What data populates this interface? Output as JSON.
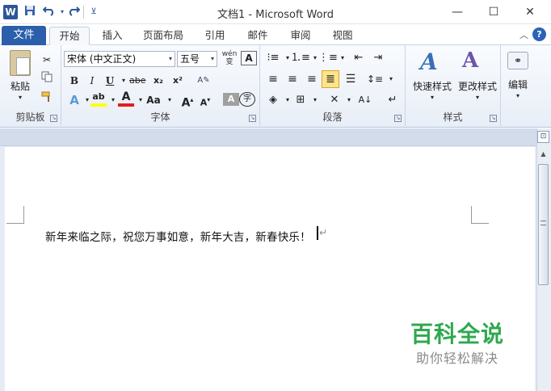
{
  "window": {
    "title": "文档1 - Microsoft Word",
    "app_icon_letter": "W",
    "controls": {
      "minimize": "—",
      "maximize": "☐",
      "close": "✕"
    }
  },
  "quick_access": {
    "save_icon": "save-icon",
    "undo_icon": "undo-icon",
    "redo_icon": "redo-icon",
    "customize_icon": "customize-qat-icon"
  },
  "tabs": {
    "file": "文件",
    "items": [
      "开始",
      "插入",
      "页面布局",
      "引用",
      "邮件",
      "审阅",
      "视图"
    ],
    "active": "开始"
  },
  "ribbon": {
    "clipboard": {
      "label": "剪贴板",
      "paste": "粘贴"
    },
    "font": {
      "label": "字体",
      "font_name": "宋体 (中文正文)",
      "font_size": "五号",
      "wen_icon": "wén",
      "bold": "B",
      "italic": "I",
      "underline": "U",
      "strike": "abe",
      "subscript": "x₂",
      "superscript": "x²",
      "grow": "A",
      "shrink": "A",
      "change_case": "Aa",
      "font_color": "A",
      "highlight": "ab",
      "text_effect": "A",
      "char_shading": "A",
      "enclose": "字"
    },
    "paragraph": {
      "label": "段落"
    },
    "styles": {
      "label": "样式",
      "quick_styles": "快速样式",
      "change_styles": "更改样式"
    },
    "editing": {
      "label": "编辑"
    }
  },
  "document": {
    "text": "新年来临之际，祝您万事如意，新年大吉，新春快乐！",
    "paragraph_mark": "↵"
  },
  "watermark": {
    "title": "百科全说",
    "subtitle": "助你轻松解决"
  },
  "colors": {
    "file_tab": "#2b5fab",
    "font_color_underline": "#e02020",
    "highlight_underline": "#ffff00",
    "watermark_green": "#2fa84f"
  }
}
